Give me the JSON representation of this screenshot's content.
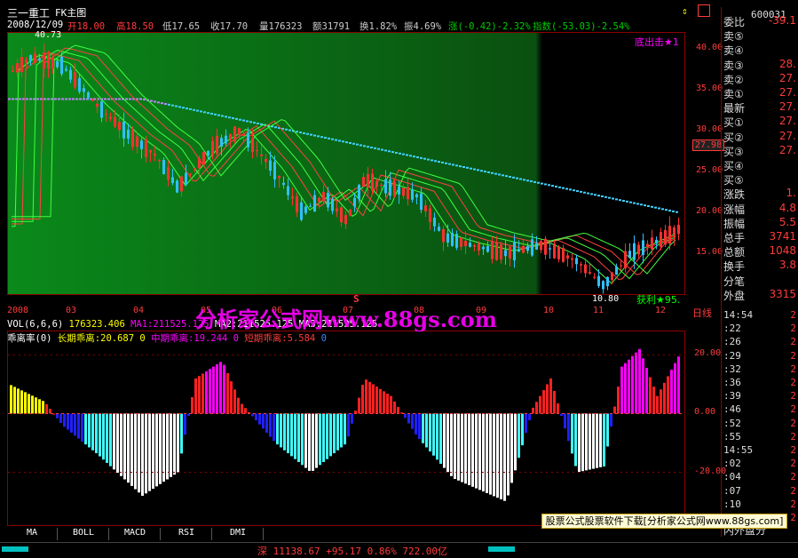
{
  "header": {
    "stock_name": "三一重工",
    "chart_label": "FK主图",
    "date_label": "2008/12/09",
    "open": "开18.00",
    "high": "高18.50",
    "low": "低17.65",
    "close": "收17.70",
    "volume": "量176323",
    "amount": "额31791",
    "turnover": "换1.82%",
    "amplitude": "振4.69%",
    "change": "涨(-0.42)-2.32%",
    "index": "指数(-53.03)-2.54%",
    "stock_code": "600031",
    "peak_label": "40.73"
  },
  "main_chart": {
    "signal_top": "底出击★1",
    "signal_bottom": "获利★95.",
    "low_label": "10.80",
    "current_price": "27.98",
    "y_ticks": [
      "40.00",
      "35.00",
      "30.00",
      "25.00",
      "20.00",
      "15.00"
    ],
    "y_values": [
      40,
      35,
      30,
      25,
      20,
      15
    ],
    "ylim": [
      10,
      42
    ],
    "x_labels": [
      "2008",
      "03",
      "04",
      "05",
      "06",
      "07",
      "08",
      "09",
      "10",
      "11",
      "12"
    ],
    "period": "日线",
    "s_marker": "S"
  },
  "volume_bar": {
    "label": "VOL(6,6,6)",
    "vol_value": "176323.406",
    "ma1": "MA1:211525.125",
    "ma2": "MA2:211525.125",
    "ma3": "MA3:211525.125"
  },
  "indicator": {
    "name": "乖离率(0)",
    "long": "长期乖离:20.687",
    "long_flag": "0",
    "mid": "中期乖离:19.244",
    "mid_flag": "0",
    "short": "短期乖离:5.584",
    "short_flag": "0",
    "y_ticks": [
      "20.00",
      "0.00",
      "-20.00"
    ],
    "y_values": [
      20,
      0,
      -20
    ],
    "ylim": [
      -38,
      28
    ],
    "colors": {
      "pos": "#ff2020",
      "pos_hi": "#ff00ff",
      "neg": "#2020ff",
      "neg_lo": "#40ffff",
      "extreme": "#ffffff",
      "yellow": "#ffff00"
    }
  },
  "right_panel": {
    "rows": [
      {
        "label": "委比",
        "value": "-39.1"
      },
      {
        "label": "卖⑤",
        "value": ""
      },
      {
        "label": "卖④",
        "value": ""
      },
      {
        "label": "卖③",
        "value": "28."
      },
      {
        "label": "卖②",
        "value": "27."
      },
      {
        "label": "卖①",
        "value": "27."
      },
      {
        "label": "最新",
        "value": "27."
      },
      {
        "label": "买①",
        "value": "27."
      },
      {
        "label": "买②",
        "value": "27."
      },
      {
        "label": "买③",
        "value": "27."
      },
      {
        "label": "买④",
        "value": ""
      },
      {
        "label": "买⑤",
        "value": ""
      },
      {
        "label": "涨跌",
        "value": "1."
      },
      {
        "label": "涨幅",
        "value": "4.8"
      },
      {
        "label": "振幅",
        "value": "5.5"
      },
      {
        "label": "总手",
        "value": "3741"
      },
      {
        "label": "总额",
        "value": "1048"
      },
      {
        "label": "换手",
        "value": "3.8"
      },
      {
        "label": "分笔",
        "value": ""
      },
      {
        "label": "外盘",
        "value": "3315"
      }
    ],
    "ticks": [
      {
        "t": "14:54",
        "v": "2"
      },
      {
        "t": ":22",
        "v": "2"
      },
      {
        "t": ":26",
        "v": "2"
      },
      {
        "t": ":29",
        "v": "2"
      },
      {
        "t": ":32",
        "v": "2"
      },
      {
        "t": ":36",
        "v": "2"
      },
      {
        "t": ":39",
        "v": "2"
      },
      {
        "t": ":46",
        "v": "2"
      },
      {
        "t": ":52",
        "v": "2"
      },
      {
        "t": ":55",
        "v": "2"
      },
      {
        "t": "14:55",
        "v": "2"
      },
      {
        "t": ":02",
        "v": "2"
      },
      {
        "t": ":04",
        "v": "2"
      },
      {
        "t": ":07",
        "v": "2"
      },
      {
        "t": ":10",
        "v": "2"
      },
      {
        "t": ":13",
        "v": "2"
      }
    ],
    "bottom": "内外盘分"
  },
  "tabs": [
    "MA",
    "BOLL",
    "MACD",
    "RSI",
    "DMI"
  ],
  "status": {
    "text": "深 11138.67 +95.17 0.86% 722.00亿"
  },
  "watermark": "分析家公式网www.88gs.com",
  "ad_banner": "股票公式股票软件下载[分析家公式网www.88gs.com]"
}
